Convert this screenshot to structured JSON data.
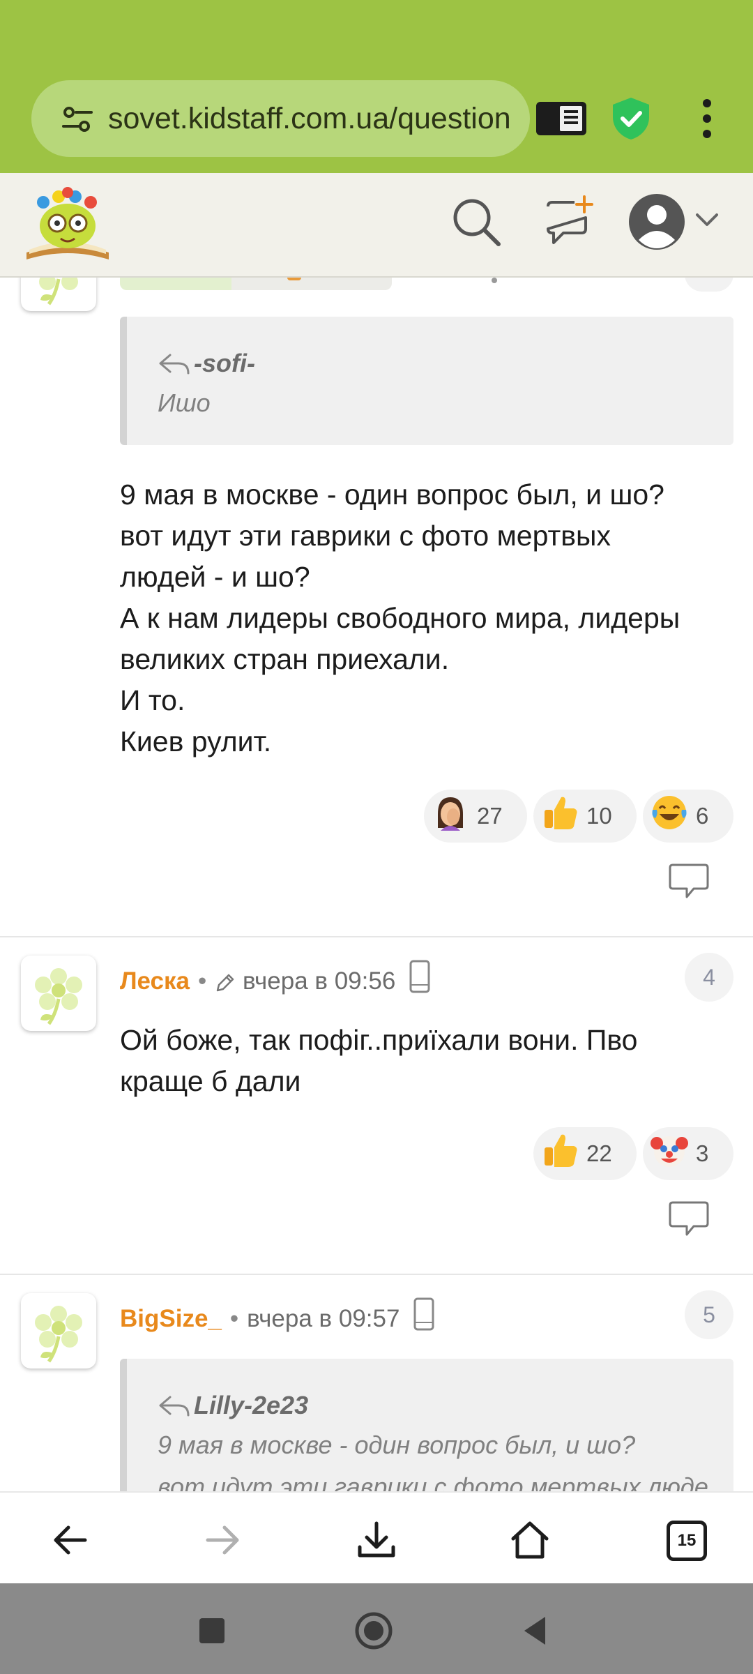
{
  "browser": {
    "url": "sovet.kidstaff.com.ua/question",
    "tabs_count": "15"
  },
  "colors": {
    "chrome": "#9dc344",
    "urlbar": "#b7d77a",
    "username": "#e8891c",
    "shield": "#2fc25b"
  },
  "header": {
    "icons": [
      "logo",
      "search-icon",
      "new-message-icon",
      "user-avatar-icon",
      "chevron-down-icon"
    ]
  },
  "comments": [
    {
      "quote": {
        "author": "-sofi-",
        "text": "Ишо"
      },
      "body": [
        "9 мая в москве - один вопрос был, и шо?",
        "вот идут эти гаврики с фото мертвых",
        "людей - и шо?",
        "А к нам лидеры свободного мира, лидеры",
        "великих стран приехали.",
        "И то.",
        "Киев рулит."
      ],
      "reactions": [
        {
          "emoji": "facepalm",
          "count": "27"
        },
        {
          "emoji": "thumbs-up",
          "count": "10"
        },
        {
          "emoji": "laughing-tears",
          "count": "6"
        }
      ]
    },
    {
      "author": "Леска",
      "time": "вчера в 09:56",
      "number": "4",
      "edited": true,
      "body": [
        "Ой боже, так пофіг..приїхали вони. Пво",
        "краще б дали"
      ],
      "reactions": [
        {
          "emoji": "thumbs-up",
          "count": "22"
        },
        {
          "emoji": "clown",
          "count": "3"
        }
      ]
    },
    {
      "author": "BigSize_",
      "time": "вчера в 09:57",
      "number": "5",
      "quote": {
        "author": "Lilly-2e23",
        "text_lines": [
          "9 мая в москве - один вопрос был, и шо?",
          "вот идут эти гаврики с фото мертвых люде..."
        ]
      }
    }
  ]
}
